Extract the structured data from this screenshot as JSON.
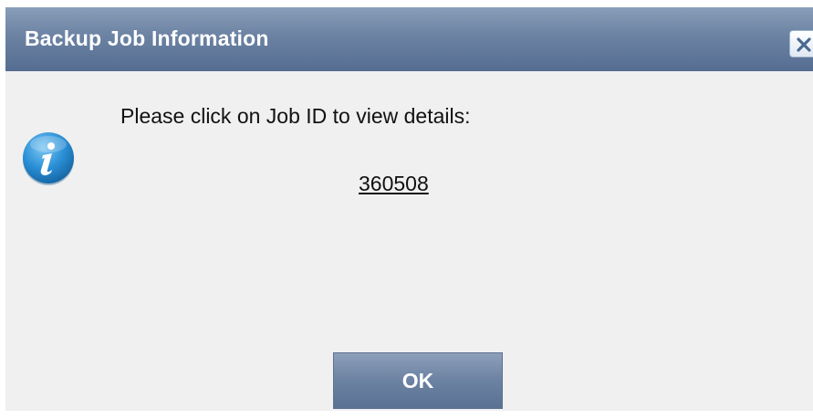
{
  "dialog": {
    "title": "Backup Job Information",
    "close_icon": "close-icon",
    "info_icon": "info-icon",
    "message": "Please click on Job ID to view details:",
    "job_id": "360508",
    "ok_label": "OK"
  },
  "colors": {
    "titlebar": "#6b82a3",
    "background": "#f0f0f0",
    "button": "#6c82a2",
    "text": "#111111"
  }
}
